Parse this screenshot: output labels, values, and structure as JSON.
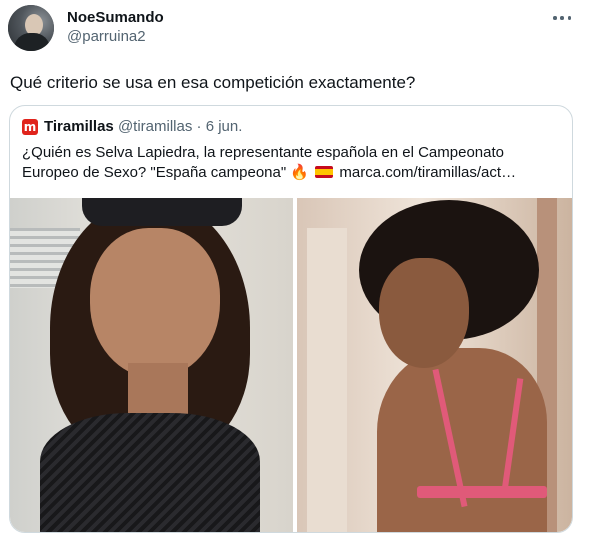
{
  "tweet": {
    "display_name": "NoeSumando",
    "handle": "@parruina2",
    "text": "Qué criterio se usa en esa competición exactamente?",
    "more_icon": "more-horizontal-icon"
  },
  "quote": {
    "logo_letter": "m",
    "logo_color": "#e0241c",
    "author_name": "Tiramillas",
    "author_handle": "@tiramillas",
    "separator": "·",
    "date": "6 jun.",
    "text_line1": "¿Quién es Selva Lapiedra, la representante española en el Campeonato",
    "text_line2_a": "Europeo de Sexo? \"España campeona\"",
    "fire_emoji": "🔥",
    "text_line2_b": "marca.com/tiramillas/act…"
  },
  "colors": {
    "text": "#0f1419",
    "secondary_text": "#536471",
    "border": "#cfd9de"
  }
}
